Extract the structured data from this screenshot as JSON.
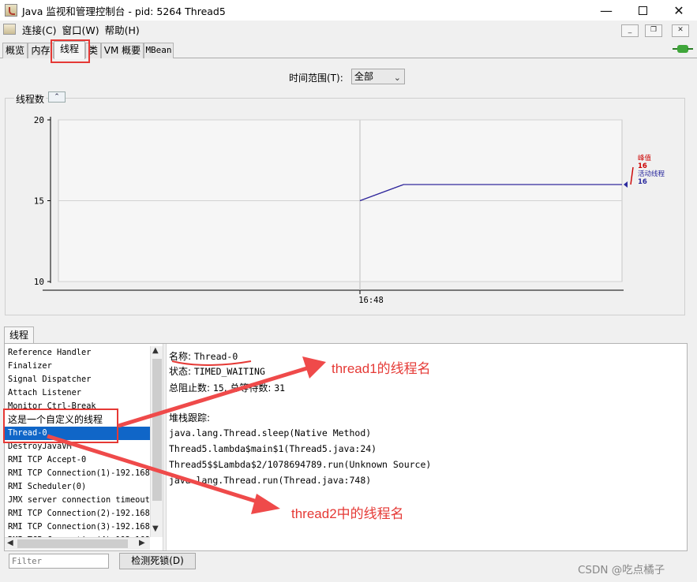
{
  "window": {
    "title": "Java 监视和管理控制台 - pid: 5264 Thread5",
    "minimize_glyph": "—",
    "close_glyph": "✕"
  },
  "menubar": {
    "items": [
      "连接(C)",
      "窗口(W)",
      "帮助(H)"
    ],
    "mdi": {
      "minimize": "_",
      "restore": "❐",
      "close": "✕"
    }
  },
  "tabs": [
    "概览",
    "内存",
    "线程",
    "类",
    "VM 概要",
    "MBean"
  ],
  "active_tab": "线程",
  "time_range": {
    "label": "时间范围(T):",
    "value": "全部"
  },
  "chart_panel": {
    "title": "线程数",
    "collapse_glyph": "⌃"
  },
  "chart_data": {
    "type": "line",
    "title": "",
    "xlabel": "",
    "ylabel": "",
    "ylim": [
      10,
      20
    ],
    "y_ticks": [
      20,
      15,
      10
    ],
    "x_tick_label": "16:48",
    "series": [
      {
        "name": "峰值",
        "color": "#cc0000",
        "x": [
          0,
          1,
          6
        ],
        "y": [
          15,
          16,
          16
        ]
      },
      {
        "name": "活动线程",
        "color": "#2b2b9e",
        "x": [
          0,
          1,
          6
        ],
        "y": [
          15,
          16,
          16
        ]
      }
    ],
    "legend": [
      {
        "label": "峰值",
        "value": "16",
        "color": "#cc0000"
      },
      {
        "label": "活动线程",
        "value": "16",
        "color": "#2b2b9e"
      }
    ],
    "legend_position": "right"
  },
  "threads_panel": {
    "tab_label": "线程",
    "list": [
      "Reference Handler",
      "Finalizer",
      "Signal Dispatcher",
      "Attach Listener",
      "Monitor Ctrl-Break",
      "这是一个自定义的线程",
      "Thread-0",
      "DestroyJavaVM",
      "RMI TCP Accept-0",
      "RMI TCP Connection(1)-192.168.",
      "RMI Scheduler(0)",
      "JMX server connection timeout",
      "RMI TCP Connection(2)-192.168.",
      "RMI TCP Connection(3)-192.168.",
      "RMI TCP Connection(4)-192.168."
    ],
    "selected": "Thread-0",
    "filter_placeholder": "Filter",
    "deadlock_button": "检测死锁(D)"
  },
  "thread_detail": {
    "name_label": "名称:",
    "name_value": "Thread-0",
    "state_label": "状态:",
    "state_value": "TIMED_WAITING",
    "blocked_label": "总阻止数:",
    "blocked_value": "15",
    "waited_label": "总等待数:",
    "waited_value": "31",
    "stack_label": "堆栈跟踪:",
    "stack": [
      "java.lang.Thread.sleep(Native Method)",
      "Thread5.lambda$main$1(Thread5.java:24)",
      "Thread5$$Lambda$2/1078694789.run(Unknown Source)",
      "java.lang.Thread.run(Thread.java:748)"
    ]
  },
  "annotations": {
    "thread1": "thread1的线程名",
    "thread2": "thread2中的线程名",
    "color": "#e53935"
  },
  "watermark": "CSDN @吃点橘子"
}
